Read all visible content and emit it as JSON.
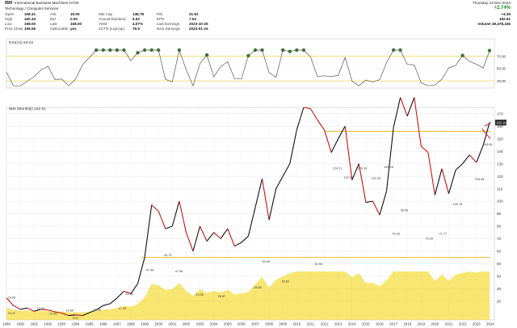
{
  "header": {
    "symbol": "IBM",
    "name": "International Business Machines NYSE",
    "sector": "Technology / Computer Services",
    "left_labels": [
      "Open",
      "High",
      "Low",
      "Prev Close"
    ],
    "left_values": [
      "158.41",
      "160.34",
      "158.00",
      "158.56"
    ],
    "mid_labels": [
      "Ask",
      "Bid",
      "Last",
      "Optionable"
    ],
    "mid_values": [
      "15.00",
      "0.00",
      "158.00",
      "yes"
    ],
    "col3_labels": [
      "Mkt Cap",
      "Annual Dividend",
      "Yield",
      "SCTR (LrgCap)"
    ],
    "col3_values": [
      "148.78",
      "6.63",
      "4.07%",
      "76.5"
    ],
    "col4_labels": [
      "P/E",
      "EPS",
      "Last Earnings",
      "Next Earnings"
    ],
    "col4_values": [
      "21.62",
      "7.54",
      "2023-10-25",
      "2024-01-24"
    ],
    "date": "Thursday 14-Dec-2023",
    "change_pct": "+2.74%",
    "change_abs": "+4.35",
    "last_price": "162.91",
    "volume": "Volume 49,478,436"
  },
  "rsi_panel": {
    "label": "RSI(14) 63.03",
    "levels": [
      70,
      50,
      30
    ],
    "tick_labels": [
      "70.00",
      "50.00",
      "30.00"
    ],
    "current": "63.03",
    "colors": {
      "line": "#555555",
      "overbought_fill": "#3a7a30",
      "level_line": "#e0c000"
    }
  },
  "price_panel": {
    "label": "IBM (Monthly) 162.91",
    "current_tag": "162.91",
    "colors": {
      "up": "#111111",
      "down": "#cc1111",
      "volume": "#f2d200",
      "support": "#e0b000",
      "arrow": "#cc1111"
    }
  },
  "chart_data": {
    "type": "line",
    "title": "IBM (Monthly) 162.91",
    "x": [
      1989,
      1989.5,
      1990,
      1990.5,
      1991,
      1991.5,
      1992,
      1992.5,
      1993,
      1993.5,
      1994,
      1994.5,
      1995,
      1995.5,
      1996,
      1996.5,
      1997,
      1997.5,
      1998,
      1998.5,
      1999,
      1999.5,
      2000,
      2000.5,
      2001,
      2001.5,
      2002,
      2002.5,
      2003,
      2003.5,
      2004,
      2004.5,
      2005,
      2005.5,
      2006,
      2006.5,
      2007,
      2007.5,
      2008,
      2008.5,
      2009,
      2009.5,
      2010,
      2010.5,
      2011,
      2011.5,
      2012,
      2012.5,
      2013,
      2013.5,
      2014,
      2014.5,
      2015,
      2015.5,
      2016,
      2016.5,
      2017,
      2017.5,
      2018,
      2018.5,
      2019,
      2019.5,
      2020,
      2020.5,
      2021,
      2021.5,
      2022,
      2022.5,
      2023,
      2023.5,
      2023.95
    ],
    "series": [
      {
        "name": "IBM (Monthly) 162.91",
        "values": [
          22.6,
          16.5,
          13.5,
          14.5,
          12.0,
          13.5,
          13.0,
          11.5,
          10.5,
          8.5,
          9.0,
          8.5,
          10.8,
          13.0,
          16.5,
          18.0,
          22.5,
          28.0,
          26.0,
          34.0,
          55.0,
          97.0,
          92.0,
          78.0,
          80.0,
          100.0,
          75.0,
          60.0,
          80.0,
          68.0,
          75.0,
          70.0,
          78.0,
          64.0,
          67.0,
          72.0,
          95.0,
          118.0,
          85.0,
          110.0,
          120.0,
          130.0,
          157.0,
          175.0,
          174.0,
          165.0,
          157.0,
          139.0,
          150.0,
          160.0,
          117.0,
          130.0,
          99.0,
          100.0,
          89.0,
          108.0,
          159.0,
          183.0,
          168.0,
          183.0,
          144.0,
          139.0,
          105.0,
          126.0,
          106.0,
          125.0,
          130.0,
          137.0,
          131.0,
          145.0,
          162.91
        ]
      }
    ],
    "annotations": [
      "20.69",
      "13.47",
      "12.09",
      "12.95",
      "10.60",
      "9.47",
      "11.30",
      "17.29",
      "23.66",
      "47.98",
      "54.70",
      "47.08",
      "23.26",
      "26.87",
      "28.84",
      "54.64",
      "33.82",
      "52.90",
      "124.11",
      "122.02",
      "124.19",
      "121.20",
      "125.18",
      "76.93",
      "90.56",
      "73.29",
      "71.77",
      "100.78",
      "115.48",
      "148.41"
    ],
    "support_levels": [
      55.0,
      156.0
    ],
    "x_tick_labels": [
      "1989",
      "1990",
      "1991",
      "1992",
      "1993",
      "1994",
      "1995",
      "1996",
      "1997",
      "1998",
      "1999",
      "2000",
      "2001",
      "2002",
      "2003",
      "2004",
      "2005",
      "2006",
      "2007",
      "2008",
      "2009",
      "2010",
      "2011",
      "2012",
      "2013",
      "2014",
      "2015",
      "2016",
      "2017",
      "2018",
      "2019",
      "2020",
      "2021",
      "2022",
      "2023",
      "2024"
    ],
    "y_ticks": [
      170,
      160,
      150,
      140,
      130,
      120,
      110,
      100,
      90,
      80,
      70,
      60,
      50,
      40,
      30,
      20
    ],
    "ylim": [
      5,
      175
    ],
    "grid": true
  }
}
